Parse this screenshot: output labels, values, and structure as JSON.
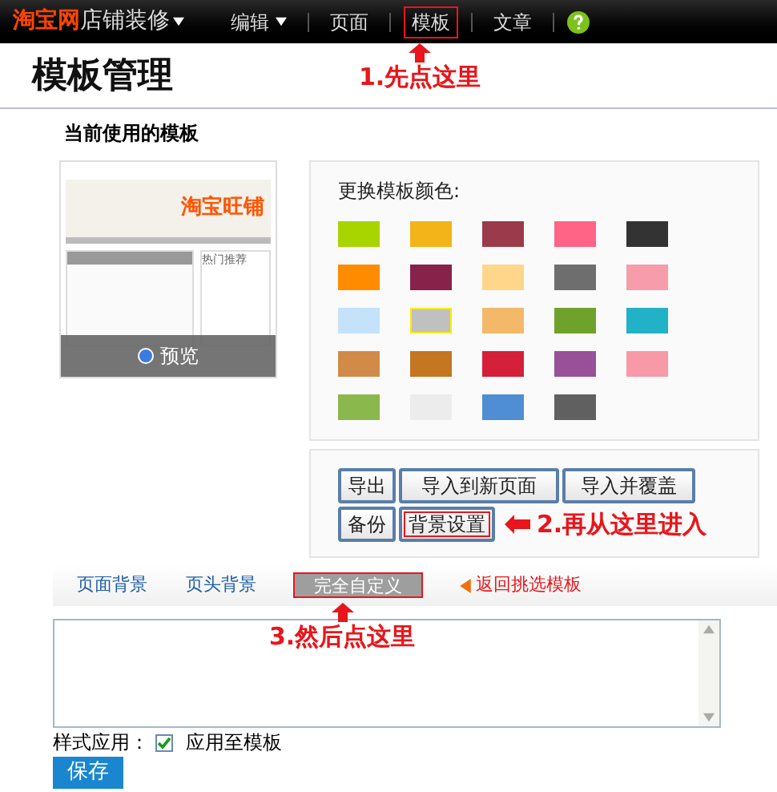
{
  "topbar": {
    "logo": "淘宝网",
    "product": "店铺装修",
    "menu": [
      {
        "label": "编辑",
        "dropdown": true,
        "annotated": false
      },
      {
        "label": "页面",
        "dropdown": false,
        "annotated": false
      },
      {
        "label": "模板",
        "dropdown": false,
        "annotated": true
      },
      {
        "label": "文章",
        "dropdown": false,
        "annotated": false
      }
    ]
  },
  "page_title": "模板管理",
  "annotations": [
    {
      "text": "1.先点这里",
      "kind": "up"
    },
    {
      "text": "2.再从这里进入",
      "kind": "left"
    },
    {
      "text": "3.然后点这里",
      "kind": "up"
    }
  ],
  "current_template": {
    "heading": "当前使用的模板",
    "thumbnail": {
      "shop_name": "淘宝旺铺",
      "section": "热门推荐",
      "preview": "预览"
    }
  },
  "colors": {
    "heading": "更换模板颜色:",
    "swatches": [
      {
        "color": "#a8d400",
        "selected": false
      },
      {
        "color": "#f2b418",
        "selected": false
      },
      {
        "color": "#9a3a4a",
        "selected": false
      },
      {
        "color": "#ff6385",
        "selected": false
      },
      {
        "color": "#333333",
        "selected": false
      },
      {
        "color": "#ff8c00",
        "selected": false
      },
      {
        "color": "#87224a",
        "selected": false
      },
      {
        "color": "#ffd68a",
        "selected": false
      },
      {
        "color": "#6e6e6e",
        "selected": false
      },
      {
        "color": "#f79cab",
        "selected": false
      },
      {
        "color": "#c4e2fa",
        "selected": false
      },
      {
        "color": "#c0c0c0",
        "selected": true
      },
      {
        "color": "#f4b968",
        "selected": false
      },
      {
        "color": "#6ea22a",
        "selected": false
      },
      {
        "color": "#22b2c8",
        "selected": false
      },
      {
        "color": "#d28a48",
        "selected": false
      },
      {
        "color": "#c47620",
        "selected": false
      },
      {
        "color": "#d42038",
        "selected": false
      },
      {
        "color": "#985098",
        "selected": false
      },
      {
        "color": "#f899a8",
        "selected": false
      },
      {
        "color": "#8ab84c",
        "selected": false
      },
      {
        "color": "#ececec",
        "selected": false
      },
      {
        "color": "#4f8ed4",
        "selected": false
      },
      {
        "color": "#606060",
        "selected": false
      }
    ]
  },
  "actions": [
    [
      {
        "label": "导出",
        "annotated": false
      },
      {
        "label": "导入到新页面",
        "annotated": false
      },
      {
        "label": "导入并覆盖",
        "annotated": false
      }
    ],
    [
      {
        "label": "备份",
        "annotated": false
      },
      {
        "label": "背景设置",
        "annotated": true
      }
    ]
  ],
  "tabs": [
    {
      "label": "页面背景",
      "selected": false,
      "annotated": false
    },
    {
      "label": "页头背景",
      "selected": false,
      "annotated": false
    },
    {
      "label": "完全自定义",
      "selected": true,
      "annotated": true
    }
  ],
  "back_link": "返回挑选模板",
  "style_apply": {
    "label": "样式应用：",
    "option": "应用至模板",
    "checked": true
  },
  "save_button": "保存"
}
